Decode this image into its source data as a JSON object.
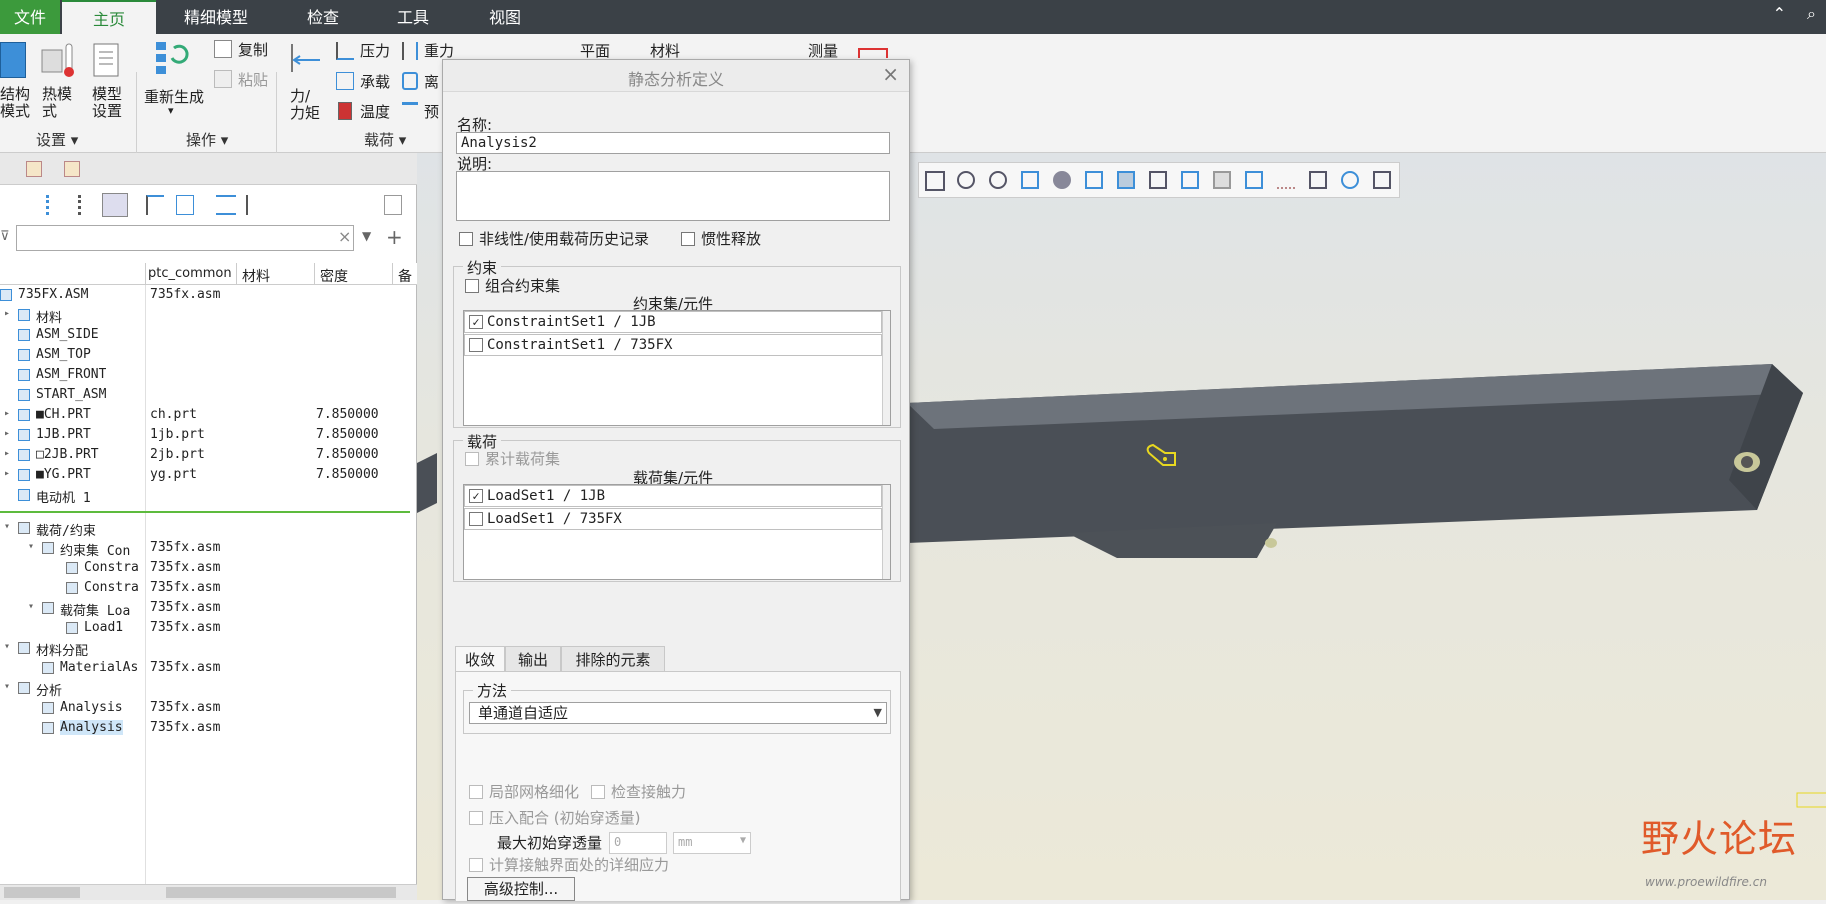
{
  "menu": {
    "tabs": [
      "文件",
      "主页",
      "精细模型",
      "检查",
      "工具",
      "视图"
    ]
  },
  "ribbon": {
    "structure_label": "结构\n模式",
    "thermal_label": "热模\n式",
    "model_setup_label": "模型\n设置",
    "regenerate_label": "重新生成",
    "copy_label": "复制",
    "paste_label": "粘贴",
    "force_label": "力/\n力矩",
    "pressure_label": "压力",
    "bearing_label": "承载",
    "temperature_label": "温度",
    "gravity_label": "重力",
    "centrifugal_label": "离",
    "preload_label": "预",
    "plane_label": "平面",
    "material_label": "材料",
    "measure_label": "测量",
    "groups": [
      "设置",
      "操作",
      "载荷"
    ]
  },
  "tree": {
    "columns": [
      "ptc_common",
      "材料",
      "密度",
      "备"
    ],
    "rows": [
      {
        "name": "735FX.ASM",
        "file": "735fx.asm",
        "density": ""
      },
      {
        "name": "材料",
        "file": "",
        "density": ""
      },
      {
        "name": "ASM_SIDE",
        "file": "",
        "density": ""
      },
      {
        "name": "ASM_TOP",
        "file": "",
        "density": ""
      },
      {
        "name": "ASM_FRONT",
        "file": "",
        "density": ""
      },
      {
        "name": "START_ASM",
        "file": "",
        "density": ""
      },
      {
        "name": "■CH.PRT",
        "file": "ch.prt",
        "density": "7.850000"
      },
      {
        "name": "1JB.PRT",
        "file": "1jb.prt",
        "density": "7.850000"
      },
      {
        "name": "□2JB.PRT",
        "file": "2jb.prt",
        "density": "7.850000"
      },
      {
        "name": "■YG.PRT",
        "file": "yg.prt",
        "density": "7.850000"
      },
      {
        "name": "电动机 1",
        "file": "",
        "density": ""
      }
    ],
    "rows2": [
      {
        "name": "载荷/约束",
        "file": ""
      },
      {
        "name": "约束集 Con",
        "file": "735fx.asm"
      },
      {
        "name": "Constra",
        "file": "735fx.asm"
      },
      {
        "name": "Constra",
        "file": "735fx.asm"
      },
      {
        "name": "载荷集 Loa",
        "file": "735fx.asm"
      },
      {
        "name": "Load1",
        "file": "735fx.asm"
      },
      {
        "name": "材料分配",
        "file": ""
      },
      {
        "name": "MaterialAs",
        "file": "735fx.asm"
      },
      {
        "name": "分析",
        "file": ""
      },
      {
        "name": "Analysis",
        "file": "735fx.asm"
      },
      {
        "name": "Analysis",
        "file": "735fx.asm"
      }
    ]
  },
  "dialog": {
    "title": "静态分析定义",
    "name_label": "名称:",
    "name_value": "Analysis2",
    "desc_label": "说明:",
    "nonlinear": "非线性/使用载荷历史记录",
    "inertia": "惯性释放",
    "constraints_title": "约束",
    "combine_constraints": "组合约束集",
    "constraint_col": "约束集/元件",
    "constraint_rows": [
      "ConstraintSet1 / 1JB",
      "ConstraintSet1 / 735FX"
    ],
    "loads_title": "载荷",
    "cumulative_loads": "累计载荷集",
    "load_col": "载荷集/元件",
    "load_rows": [
      "LoadSet1 / 1JB",
      "LoadSet1 / 735FX"
    ],
    "tabs": [
      "收敛",
      "输出",
      "排除的元素"
    ],
    "method_title": "方法",
    "method_value": "单通道自适应",
    "local_mesh": "局部网格细化",
    "check_contact": "检查接触力",
    "press_fit": "压入配合 (初始穿透量)",
    "max_penetration": "最大初始穿透量",
    "pen_value": "0",
    "pen_unit": "mm",
    "detailed_stress": "计算接触界面处的详细应力",
    "advanced": "高级控制..."
  },
  "watermark": {
    "text": "野火论坛",
    "url": "www.proewildfire.cn"
  },
  "colors": {
    "accent": "#2a8a3a",
    "menubar": "#3b4147"
  }
}
